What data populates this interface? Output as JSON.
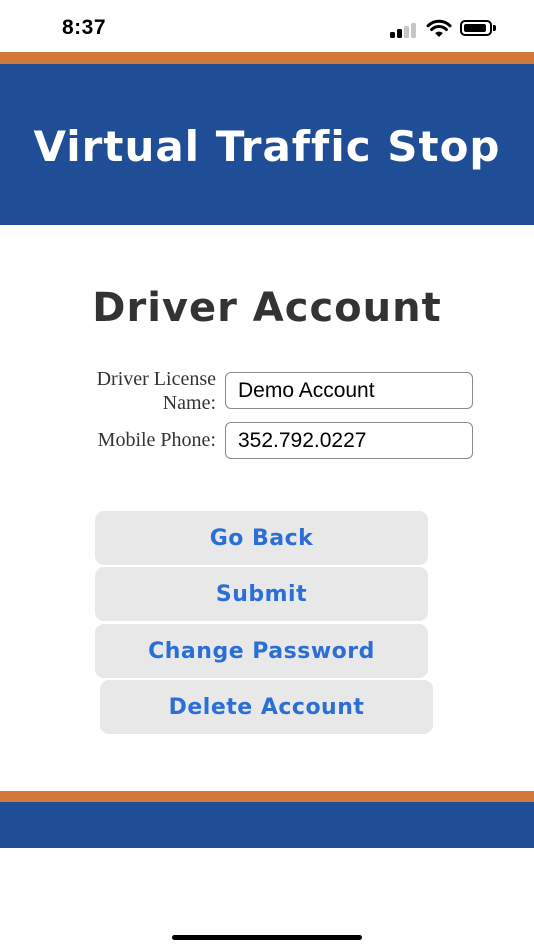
{
  "status_bar": {
    "time": "8:37",
    "signal_icon": "cellular-signal-icon",
    "wifi_icon": "wifi-icon",
    "battery_icon": "battery-icon"
  },
  "header": {
    "title": "Virtual Traffic Stop"
  },
  "main": {
    "page_title": "Driver Account",
    "fields": {
      "license_name": {
        "label": "Driver License Name:",
        "value": "Demo Account"
      },
      "mobile_phone": {
        "label": "Mobile Phone:",
        "value": "352.792.0227"
      }
    },
    "buttons": {
      "go_back": "Go Back",
      "submit": "Submit",
      "change_password": "Change Password",
      "delete_account": "Delete Account"
    }
  },
  "colors": {
    "brand_blue": "#1f4e96",
    "accent_orange": "#d4773a",
    "button_text": "#2b6fd6",
    "button_bg": "#e8e8e8"
  }
}
